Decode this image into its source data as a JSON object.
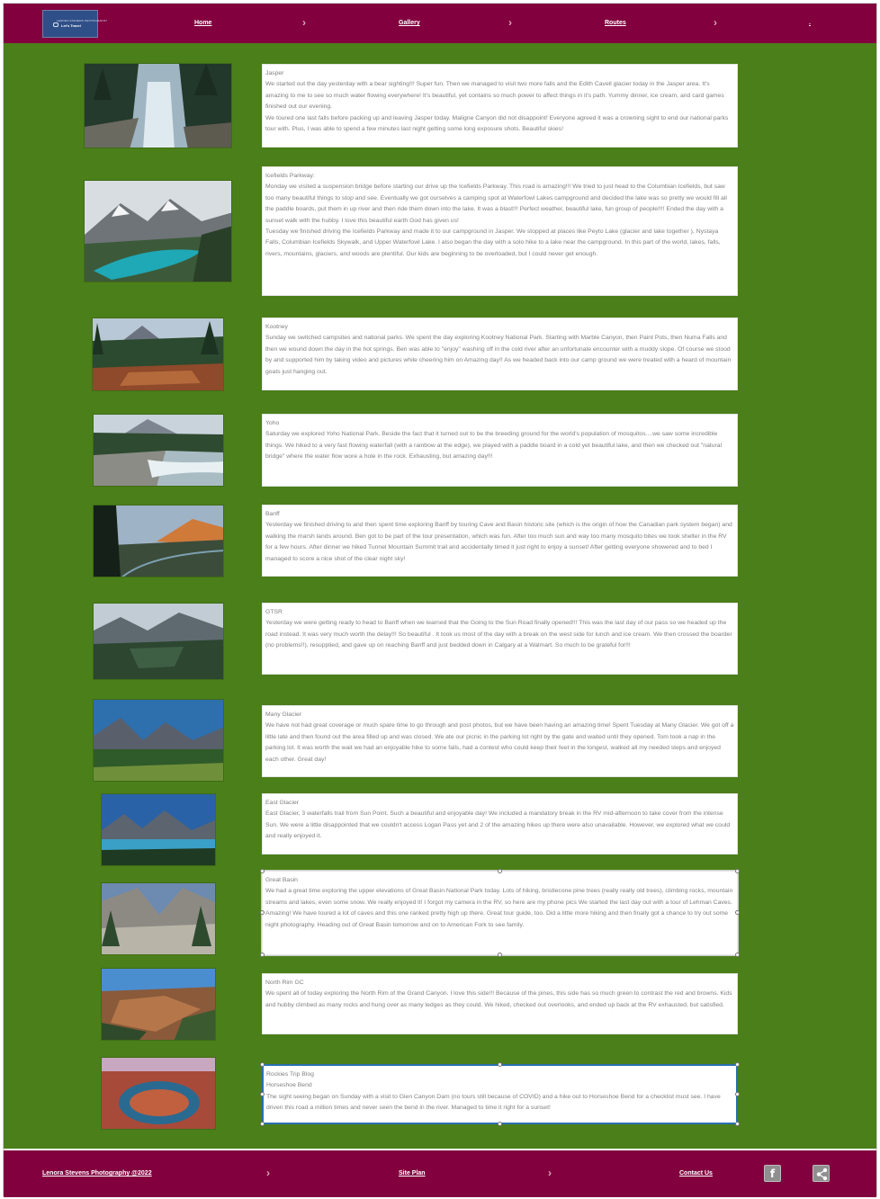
{
  "header": {
    "logo": {
      "tagline": "LENORA STEVENS PHOTOGRAPHY",
      "name": "Let's Travel"
    },
    "nav": [
      "Home",
      "Gallery",
      "Routes",
      "."
    ]
  },
  "posts": [
    {
      "title": "Jasper",
      "paragraphs": [
        "We started out the day yesterday with a bear sighting!!! Super fun. Then we managed to visit two more falls and the Edith Cavell glacier today in the Jasper area. It's amazing to me to see so much water flowing everywhere! It's beautiful, yet contains so much power to affect things in it's path. Yummy dinner, ice cream, and card games finished out our evening.",
        "We toured one last falls before packing up and leaving Jasper today. Maligne Canyon did not disappoint! Everyone agreed it was a crowning sight to end our national parks tour with. Plus, I was able to spend a few minutes last night getting some long exposure shots. Beautiful skies!"
      ]
    },
    {
      "title": "Icefields Parkway:",
      "paragraphs": [
        "Monday we visited a suspension bridge before starting our drive up the Icefields Parkway. This road is amazing!!! We tried to just head to the Columbian Icefields, but saw too many beautiful things to stop and see. Eventually we got ourselves a camping spot at Waterfowl Lakes campground and decided the lake was so pretty we would fill all the paddle boards, put them in up river and then ride them down into the lake. It was a blast!!! Perfect weather, beautiful lake, fun group of people!!!! Ended the day with a sunset walk with the hubby. I love this beautiful earth God has given us!",
        "Tuesday we finished driving the Icefields Parkway and made it to our campground in Jasper. We stopped at places like Peyto Lake (glacier and lake together ), Nystaya Falls, Columbian Icefields Skywalk, and Upper Waterfowl Lake. I also began the day with a solo hike to a lake near the campground. In this part of the world, lakes, falls, rivers, mountains, glaciers, and woods are plentiful. Our kids are beginning to be overloaded, but I could never get enough."
      ]
    },
    {
      "title": "Kootney",
      "paragraphs": [
        "Sunday we switched campsites and national parks. We spent the day exploring Kootney National Park. Starting with Marble Canyon, then Paint Pots, then Numa Falls and then we wound down the day in the hot springs. Ben was able to \"enjoy\" washing off in the cold river after an unfortunate encounter with a muddy slope. Of course we stood by and supported him by taking video and pictures while cheering him on Amazing day!! As we headed back into our camp ground we were treated with a heard of mountain goats just hanging out."
      ]
    },
    {
      "title": "Yoho",
      "paragraphs": [
        "Saturday we explored Yoho National Park. Beside the fact that it turned out to be the breeding ground for the world's population of mosquitos....we saw some incredible things. We hiked to a very fast flowing waterfall (with a rainbow at the edge), we played with a paddle board in a cold yet beautiful lake, and then we checked out \"natural bridge\" where the water flow wore a hole in the rock. Exhausting, but amazing day!!!"
      ]
    },
    {
      "title": "Banff",
      "paragraphs": [
        "Yesterday we finished driving to and then spent time exploring Banff by touring Cave and Basin historic site (which is the origin of how the Canadian park system began) and walking the marsh lands around. Ben got to be part of the tour presentation, which was fun. After too much sun and way too many mosquito bites we took shelter in the RV for a few hours. After dinner we hiked Tunnel Mountain Summit trail and accidentally timed it just right to enjoy a sunset! After getting everyone showered and to bed I managed to score a nice shot of the clear night sky!"
      ]
    },
    {
      "title": "GTSR",
      "paragraphs": [
        "Yesterday we were getting ready to head to Banff when we learned that the Going to the Sun Road finally opened!!! This was the last day of our pass so we headed up the road instead. It was very much worth the delay!!! So beautiful . It took us most of the day with a break on the west side for lunch and ice cream. We then crossed the boarder (no problems!!), resupplied, and gave up on reaching Banff and just bedded down in Calgary at a Walmart. So much to be grateful for!!!"
      ]
    },
    {
      "title": "Many Glacier",
      "paragraphs": [
        "We have not had great coverage or much spare time to go through and post photos, but we have been having an amazing time! Spent Tuesday at Many Glacier. We got off a little late and then found out the area filled up and was closed. We ate our picnic in the parking lot right by the gate and waited until they opened. Tom took a nap in the parking lot. It was worth the wait we had an enjoyable hike to some falls, had a contest who could keep their feet in the longest, walked all my needed steps and enjoyed each other. Great day!"
      ]
    },
    {
      "title": "East Glacier",
      "paragraphs": [
        "East Glacier, 3 waterfalls trail from Sun Point. Such a beautiful and enjoyable day! We included a mandatory break in the RV mid-afternoon to take cover from the intense Sun. We were a little disappointed that we couldn't access Logan Pass yet and 2 of the amazing hikes up there were also unavailable. However, we explored what we could and really enjoyed it."
      ]
    },
    {
      "title": "Great Basin",
      "paragraphs": [
        "We had a great time exploring the upper elevations of Great Basin National Park today. Lots of hiking, bristlecone pine trees (really really old trees), climbing rocks, mountain streams and lakes, even some snow. We really enjoyed it! I forgot my camera in the RV, so here are my phone pics We started the last day out with a tour of Lehman Caves. Amazing! We have toured a lot of caves and this one ranked pretty high up there. Great tour guide, too. Did a little more hiking and then finally got a chance to try out some night photography. Heading out of Great Basin tomorrow and on to American Fork to see family."
      ]
    },
    {
      "title": "North Rim GC",
      "paragraphs": [
        "We spent all of today exploring the North Rim of the Grand Canyon. I love this side!!! Because of the pines, this side has so much green to contrast the red and browns. Kids and hubby climbed as many rocks and hung over as many ledges as they could. We hiked, checked out overlooks, and ended up back at the RV exhausted, but satisfied."
      ]
    },
    {
      "title": "Rockies Trip Blog",
      "paragraphs": [
        "Horseshoe Bend",
        "The sight seeing began on Sunday with a visit to Glen Canyon Dam (no tours still because of COVID) and a hike out to Horseshoe Bend for a checklist must see. I have driven this road a million times and never seen the bend in the river. Managed to time it right for a sunset!"
      ]
    }
  ],
  "footer": {
    "copyright": "Lenora Stevens Photography @2022",
    "site_plan": "Site Plan",
    "contact": "Contact Us",
    "icons": [
      "facebook-icon",
      "share-icon"
    ]
  },
  "colors": {
    "nav": "#82003e",
    "main": "#4b7f1a",
    "focus": "#2a6fb0"
  }
}
